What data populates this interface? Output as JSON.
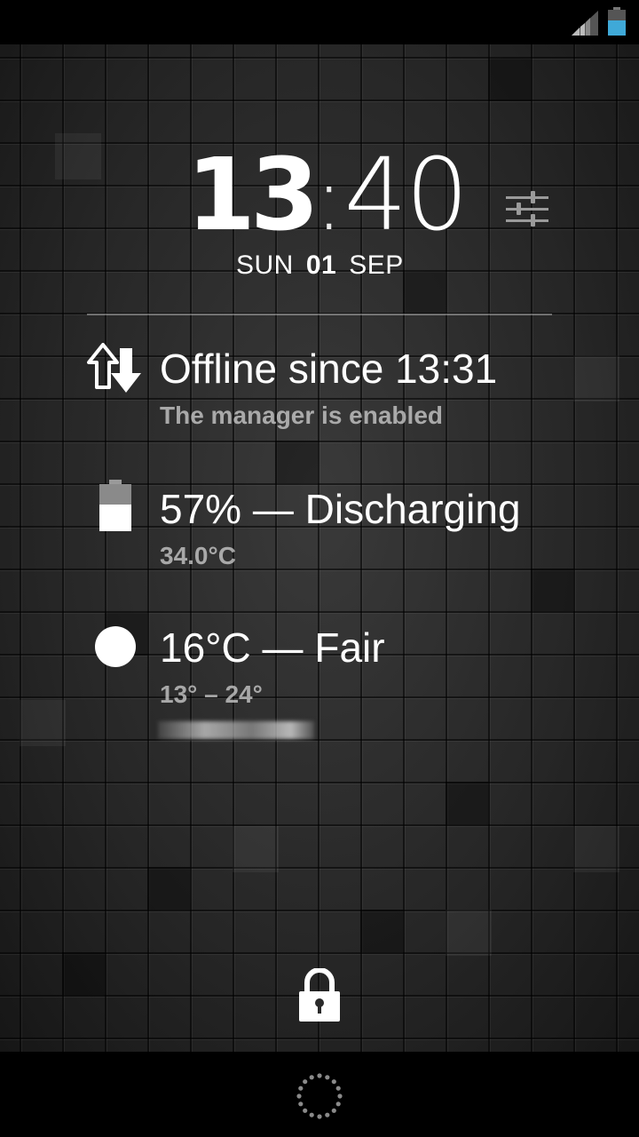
{
  "status_bar": {
    "icons": [
      "signal-icon",
      "battery-icon"
    ],
    "battery_color": "#3fa9d8"
  },
  "clock": {
    "hours": "13",
    "separator": ":",
    "minutes": "40"
  },
  "date": {
    "weekday": "SUN",
    "day": "01",
    "month": "SEP"
  },
  "widgets": {
    "network": {
      "icon": "sync-arrows-icon",
      "title": "Offline since 13:31",
      "subtitle": "The manager is enabled"
    },
    "battery": {
      "icon": "battery-icon",
      "title": "57% — Discharging",
      "subtitle": "34.0°C",
      "level": 0.57
    },
    "weather": {
      "icon": "sun-icon",
      "title": "16°C — Fair",
      "subtitle": "13° – 24°"
    }
  },
  "lock": {
    "icon": "lock-icon"
  },
  "nav_bar": {
    "icon": "loading-icon"
  }
}
